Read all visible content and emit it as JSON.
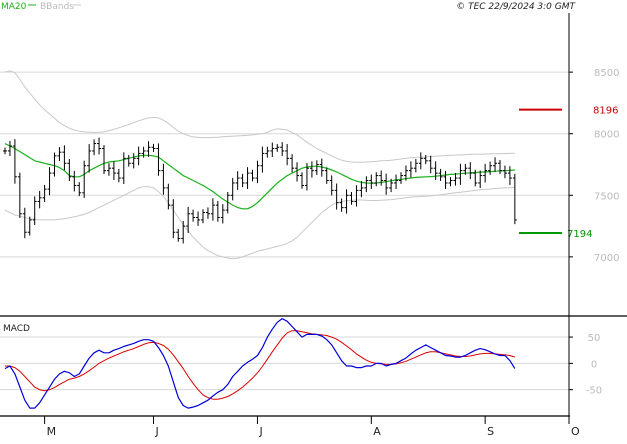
{
  "header": {
    "legend_ma": "MA20",
    "legend_bbands": "BBands",
    "copyright": "© TEC 22/9/2024 3:0 GMT"
  },
  "colors": {
    "price": "#000000",
    "ma": "#19b219",
    "bands": "#c8c8c8",
    "resistance": "#cc0000",
    "support": "#009900",
    "macd": "#0000dd",
    "signal": "#dd0000",
    "grid": "#d8d8d8",
    "frame": "#000000"
  },
  "chart_data": [
    {
      "type": "ohlc",
      "panel": "price",
      "ylim": [
        6520,
        8980
      ],
      "yticks": [
        {
          "value": 8500,
          "label": "8500"
        },
        {
          "value": 8000,
          "label": "8000"
        },
        {
          "value": 7500,
          "label": "7500"
        },
        {
          "value": 7000,
          "label": "7000"
        }
      ],
      "x_months": [
        {
          "label": "M",
          "index": 8
        },
        {
          "label": "J",
          "index": 30
        },
        {
          "label": "J",
          "index": 51
        },
        {
          "label": "A",
          "index": 74
        },
        {
          "label": "S",
          "index": 97
        },
        {
          "label": "O",
          "index": 121
        }
      ],
      "closes": [
        7860,
        7900,
        7650,
        7350,
        7200,
        7300,
        7450,
        7480,
        7550,
        7680,
        7820,
        7850,
        7760,
        7650,
        7580,
        7520,
        7740,
        7860,
        7920,
        7880,
        7700,
        7720,
        7680,
        7640,
        7800,
        7760,
        7800,
        7840,
        7860,
        7890,
        7880,
        7700,
        7560,
        7420,
        7200,
        7150,
        7250,
        7350,
        7320,
        7300,
        7360,
        7350,
        7420,
        7320,
        7380,
        7500,
        7600,
        7640,
        7600,
        7680,
        7640,
        7740,
        7840,
        7860,
        7880,
        7890,
        7860,
        7800,
        7720,
        7660,
        7580,
        7720,
        7700,
        7750,
        7700,
        7620,
        7540,
        7440,
        7400,
        7500,
        7450,
        7540,
        7560,
        7620,
        7600,
        7660,
        7620,
        7560,
        7600,
        7620,
        7660,
        7700,
        7720,
        7760,
        7800,
        7780,
        7720,
        7680,
        7650,
        7600,
        7620,
        7640,
        7700,
        7720,
        7680,
        7600,
        7660,
        7700,
        7740,
        7760,
        7700,
        7680,
        7640,
        7300
      ],
      "overlays": [
        {
          "name": "MA20",
          "values": [
            7920,
            7900,
            7880,
            7855,
            7830,
            7805,
            7780,
            7770,
            7760,
            7750,
            7740,
            7725,
            7700,
            7660,
            7650,
            7650,
            7670,
            7700,
            7720,
            7740,
            7760,
            7770,
            7775,
            7780,
            7790,
            7800,
            7810,
            7820,
            7825,
            7825,
            7820,
            7810,
            7780,
            7750,
            7720,
            7690,
            7660,
            7640,
            7620,
            7600,
            7580,
            7555,
            7530,
            7500,
            7470,
            7445,
            7420,
            7400,
            7390,
            7390,
            7410,
            7440,
            7480,
            7520,
            7560,
            7600,
            7630,
            7660,
            7680,
            7700,
            7720,
            7730,
            7735,
            7735,
            7730,
            7720,
            7705,
            7690,
            7670,
            7650,
            7630,
            7615,
            7605,
            7600,
            7598,
            7600,
            7605,
            7610,
            7618,
            7625,
            7630,
            7635,
            7640,
            7645,
            7648,
            7650,
            7652,
            7655,
            7660,
            7665,
            7670,
            7672,
            7675,
            7680,
            7682,
            7685,
            7688,
            7690,
            7692,
            7695,
            7698,
            7700,
            7702,
            7705
          ]
        },
        {
          "name": "BBands upper",
          "values": [
            8500,
            8510,
            8495,
            8440,
            8380,
            8330,
            8280,
            8235,
            8195,
            8160,
            8125,
            8090,
            8065,
            8045,
            8030,
            8020,
            8015,
            8012,
            8010,
            8012,
            8015,
            8025,
            8035,
            8048,
            8062,
            8075,
            8090,
            8105,
            8118,
            8128,
            8132,
            8128,
            8110,
            8085,
            8050,
            8020,
            8000,
            7985,
            7975,
            7970,
            7968,
            7968,
            7970,
            7972,
            7975,
            7978,
            7980,
            7982,
            7985,
            7988,
            7990,
            7995,
            8000,
            8010,
            8030,
            8040,
            8035,
            8030,
            8010,
            7990,
            7960,
            7930,
            7905,
            7880,
            7860,
            7840,
            7820,
            7800,
            7785,
            7775,
            7770,
            7768,
            7768,
            7770,
            7772,
            7775,
            7780,
            7782,
            7785,
            7790,
            7795,
            7800,
            7805,
            7808,
            7810,
            7812,
            7815,
            7818,
            7820,
            7822,
            7825,
            7826,
            7828,
            7830,
            7832,
            7833,
            7834,
            7835,
            7836,
            7837,
            7838,
            7839,
            7840,
            7840
          ]
        },
        {
          "name": "BBands lower",
          "values": [
            7380,
            7360,
            7340,
            7330,
            7320,
            7310,
            7305,
            7300,
            7300,
            7300,
            7300,
            7305,
            7310,
            7318,
            7325,
            7335,
            7345,
            7360,
            7380,
            7400,
            7420,
            7440,
            7460,
            7480,
            7500,
            7520,
            7540,
            7560,
            7570,
            7570,
            7560,
            7530,
            7490,
            7440,
            7380,
            7320,
            7260,
            7210,
            7160,
            7120,
            7080,
            7050,
            7030,
            7010,
            7000,
            6990,
            6985,
            6990,
            7000,
            7015,
            7030,
            7045,
            7055,
            7065,
            7075,
            7085,
            7095,
            7110,
            7130,
            7160,
            7200,
            7240,
            7280,
            7320,
            7360,
            7390,
            7420,
            7440,
            7450,
            7455,
            7460,
            7462,
            7462,
            7460,
            7458,
            7458,
            7460,
            7462,
            7465,
            7470,
            7475,
            7480,
            7485,
            7488,
            7490,
            7492,
            7495,
            7500,
            7505,
            7510,
            7515,
            7520,
            7525,
            7530,
            7535,
            7540,
            7545,
            7548,
            7550,
            7555,
            7558,
            7560,
            7562,
            7565
          ]
        }
      ],
      "levels": [
        {
          "name": "resistance",
          "value": 8196,
          "label": "8196"
        },
        {
          "name": "support",
          "value": 7194,
          "label": "7194"
        }
      ]
    },
    {
      "type": "line",
      "panel": "macd",
      "title": "MACD",
      "ylim": [
        -100,
        90
      ],
      "yticks": [
        {
          "value": 50,
          "label": "50"
        },
        {
          "value": 0,
          "label": "0"
        },
        {
          "value": -50,
          "label": "-50"
        }
      ],
      "series": [
        {
          "name": "MACD",
          "values": [
            -10,
            -5,
            -20,
            -45,
            -70,
            -85,
            -85,
            -75,
            -60,
            -45,
            -30,
            -20,
            -15,
            -18,
            -25,
            -20,
            -5,
            10,
            20,
            25,
            20,
            20,
            25,
            28,
            32,
            35,
            38,
            42,
            45,
            45,
            42,
            30,
            15,
            -5,
            -35,
            -65,
            -80,
            -85,
            -83,
            -80,
            -75,
            -70,
            -62,
            -55,
            -50,
            -40,
            -25,
            -15,
            -5,
            2,
            8,
            15,
            30,
            50,
            65,
            78,
            85,
            80,
            70,
            60,
            50,
            55,
            55,
            55,
            52,
            45,
            35,
            20,
            5,
            -5,
            -5,
            -8,
            -8,
            -5,
            -5,
            0,
            0,
            -5,
            -2,
            0,
            5,
            10,
            18,
            25,
            30,
            35,
            30,
            25,
            20,
            15,
            14,
            12,
            12,
            15,
            20,
            25,
            28,
            26,
            22,
            18,
            15,
            15,
            5,
            -10
          ]
        },
        {
          "name": "Signal",
          "values": [
            -5,
            -5,
            -8,
            -15,
            -25,
            -35,
            -45,
            -50,
            -52,
            -50,
            -46,
            -40,
            -35,
            -30,
            -28,
            -25,
            -20,
            -14,
            -7,
            0,
            5,
            10,
            14,
            18,
            22,
            25,
            28,
            32,
            36,
            39,
            40,
            38,
            34,
            27,
            16,
            3,
            -10,
            -25,
            -38,
            -50,
            -60,
            -65,
            -68,
            -68,
            -66,
            -63,
            -58,
            -52,
            -45,
            -37,
            -28,
            -18,
            -6,
            8,
            22,
            35,
            48,
            58,
            62,
            62,
            60,
            58,
            56,
            55,
            54,
            53,
            50,
            46,
            40,
            33,
            26,
            18,
            12,
            6,
            2,
            0,
            -1,
            -2,
            -2,
            -1,
            1,
            4,
            8,
            12,
            16,
            20,
            22,
            22,
            20,
            18,
            16,
            14,
            13,
            13,
            14,
            16,
            18,
            19,
            19,
            18,
            17,
            16,
            15,
            12
          ]
        }
      ]
    }
  ]
}
